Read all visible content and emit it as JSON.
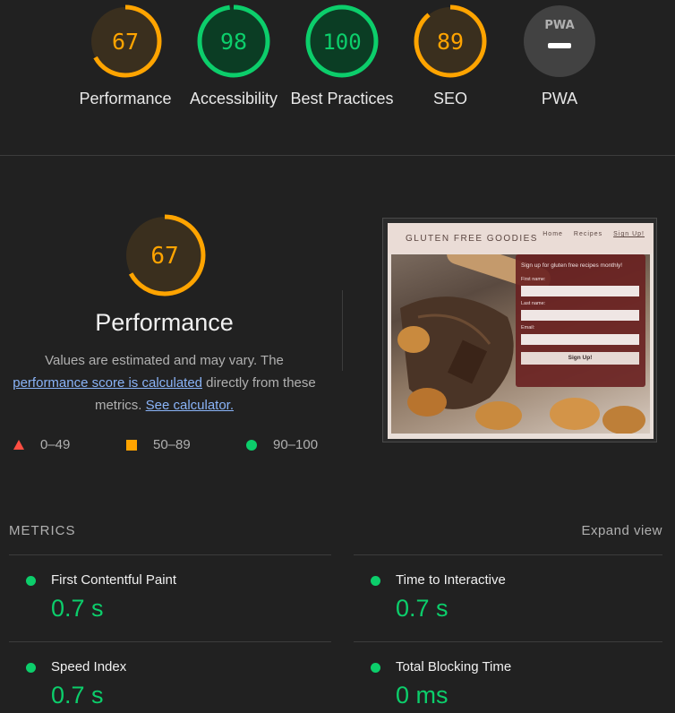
{
  "colors": {
    "pass": "#0cce6b",
    "average": "#ffa400",
    "fail": "#ff4e42",
    "pass_bg": "#0b3d24",
    "average_bg": "#3a2f1e",
    "neutral_bg": "#424242",
    "link": "#8ab4f8"
  },
  "gauges": [
    {
      "score": "67",
      "fraction": 0.67,
      "label": "Performance",
      "status": "average"
    },
    {
      "score": "98",
      "fraction": 0.98,
      "label": "Accessibility",
      "status": "pass"
    },
    {
      "score": "100",
      "fraction": 1.0,
      "label": "Best Practices",
      "status": "pass"
    },
    {
      "score": "89",
      "fraction": 0.89,
      "label": "SEO",
      "status": "average"
    },
    {
      "score": "PWA",
      "label": "PWA",
      "status": "neutral",
      "icon": "pwa-badge-icon"
    }
  ],
  "performance": {
    "score": "67",
    "fraction": 0.67,
    "title": "Performance",
    "desc_prefix": "Values are estimated and may vary. The ",
    "desc_link1": "performance score is calculated",
    "desc_mid": " directly from these metrics. ",
    "desc_link2": "See calculator.",
    "legend": [
      {
        "icon": "triangle-fail-icon",
        "range": "0–49"
      },
      {
        "icon": "square-average-icon",
        "range": "50–89"
      },
      {
        "icon": "circle-pass-icon",
        "range": "90–100"
      }
    ]
  },
  "screenshot": {
    "logo": "GLUTEN FREE GOODIES",
    "nav": [
      "Home",
      "Recipes",
      "Sign Up!"
    ],
    "form_heading": "Sign up for gluten free recipes monthly!",
    "fields": [
      "First name:",
      "Last name:",
      "Email:"
    ],
    "button": "Sign Up!"
  },
  "metrics": {
    "header": "METRICS",
    "expand_label": "Expand view",
    "items": [
      {
        "name": "First Contentful Paint",
        "value": "0.7 s"
      },
      {
        "name": "Time to Interactive",
        "value": "0.7 s"
      },
      {
        "name": "Speed Index",
        "value": "0.7 s"
      },
      {
        "name": "Total Blocking Time",
        "value": "0 ms"
      }
    ]
  }
}
